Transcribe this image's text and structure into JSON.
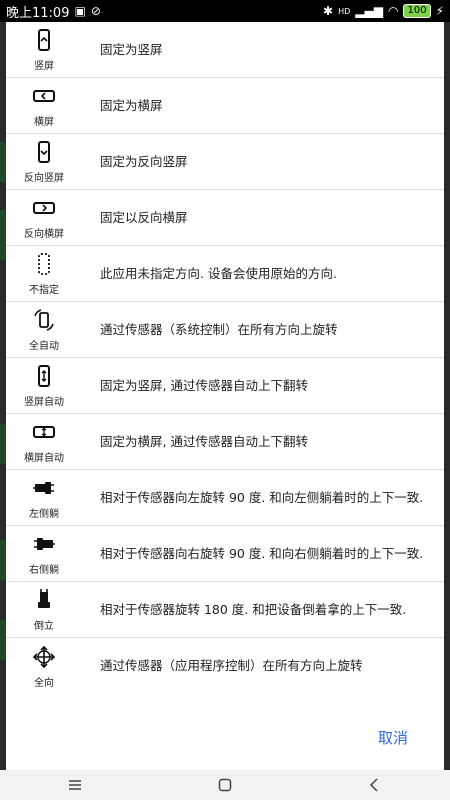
{
  "status_bar": {
    "time": "晚上11:09",
    "battery": "100",
    "signal": "HD"
  },
  "options": [
    {
      "icon": "portrait-icon",
      "label": "竖屏",
      "desc": "固定为竖屏"
    },
    {
      "icon": "landscape-icon",
      "label": "横屏",
      "desc": "固定为横屏"
    },
    {
      "icon": "reverse-portrait-icon",
      "label": "反向竖屏",
      "desc": "固定为反向竖屏"
    },
    {
      "icon": "reverse-landscape-icon",
      "label": "反向横屏",
      "desc": "固定以反向横屏"
    },
    {
      "icon": "unspecified-icon",
      "label": "不指定",
      "desc": "此应用未指定方向. 设备会使用原始的方向."
    },
    {
      "icon": "auto-rotate-icon",
      "label": "全自动",
      "desc": "通过传感器（系统控制）在所有方向上旋转"
    },
    {
      "icon": "portrait-auto-icon",
      "label": "竖屏自动",
      "desc": "固定为竖屏, 通过传感器自动上下翻转"
    },
    {
      "icon": "landscape-auto-icon",
      "label": "横屏自动",
      "desc": "固定为横屏, 通过传感器自动上下翻转"
    },
    {
      "icon": "lie-left-icon",
      "label": "左侧躺",
      "desc": "相对于传感器向左旋转 90 度. 和向左侧躺着时的上下一致."
    },
    {
      "icon": "lie-right-icon",
      "label": "右侧躺",
      "desc": "相对于传感器向右旋转 90 度. 和向右侧躺着时的上下一致."
    },
    {
      "icon": "upside-down-icon",
      "label": "倒立",
      "desc": "相对于传感器旋转 180 度. 和把设备倒着拿的上下一致."
    },
    {
      "icon": "all-directions-icon",
      "label": "全向",
      "desc": "通过传感器（应用程序控制）在所有方向上旋转"
    }
  ],
  "footer": {
    "cancel_label": "取消"
  },
  "colors": {
    "accent": "#2f6ad9",
    "divider": "#e0e0e0"
  }
}
